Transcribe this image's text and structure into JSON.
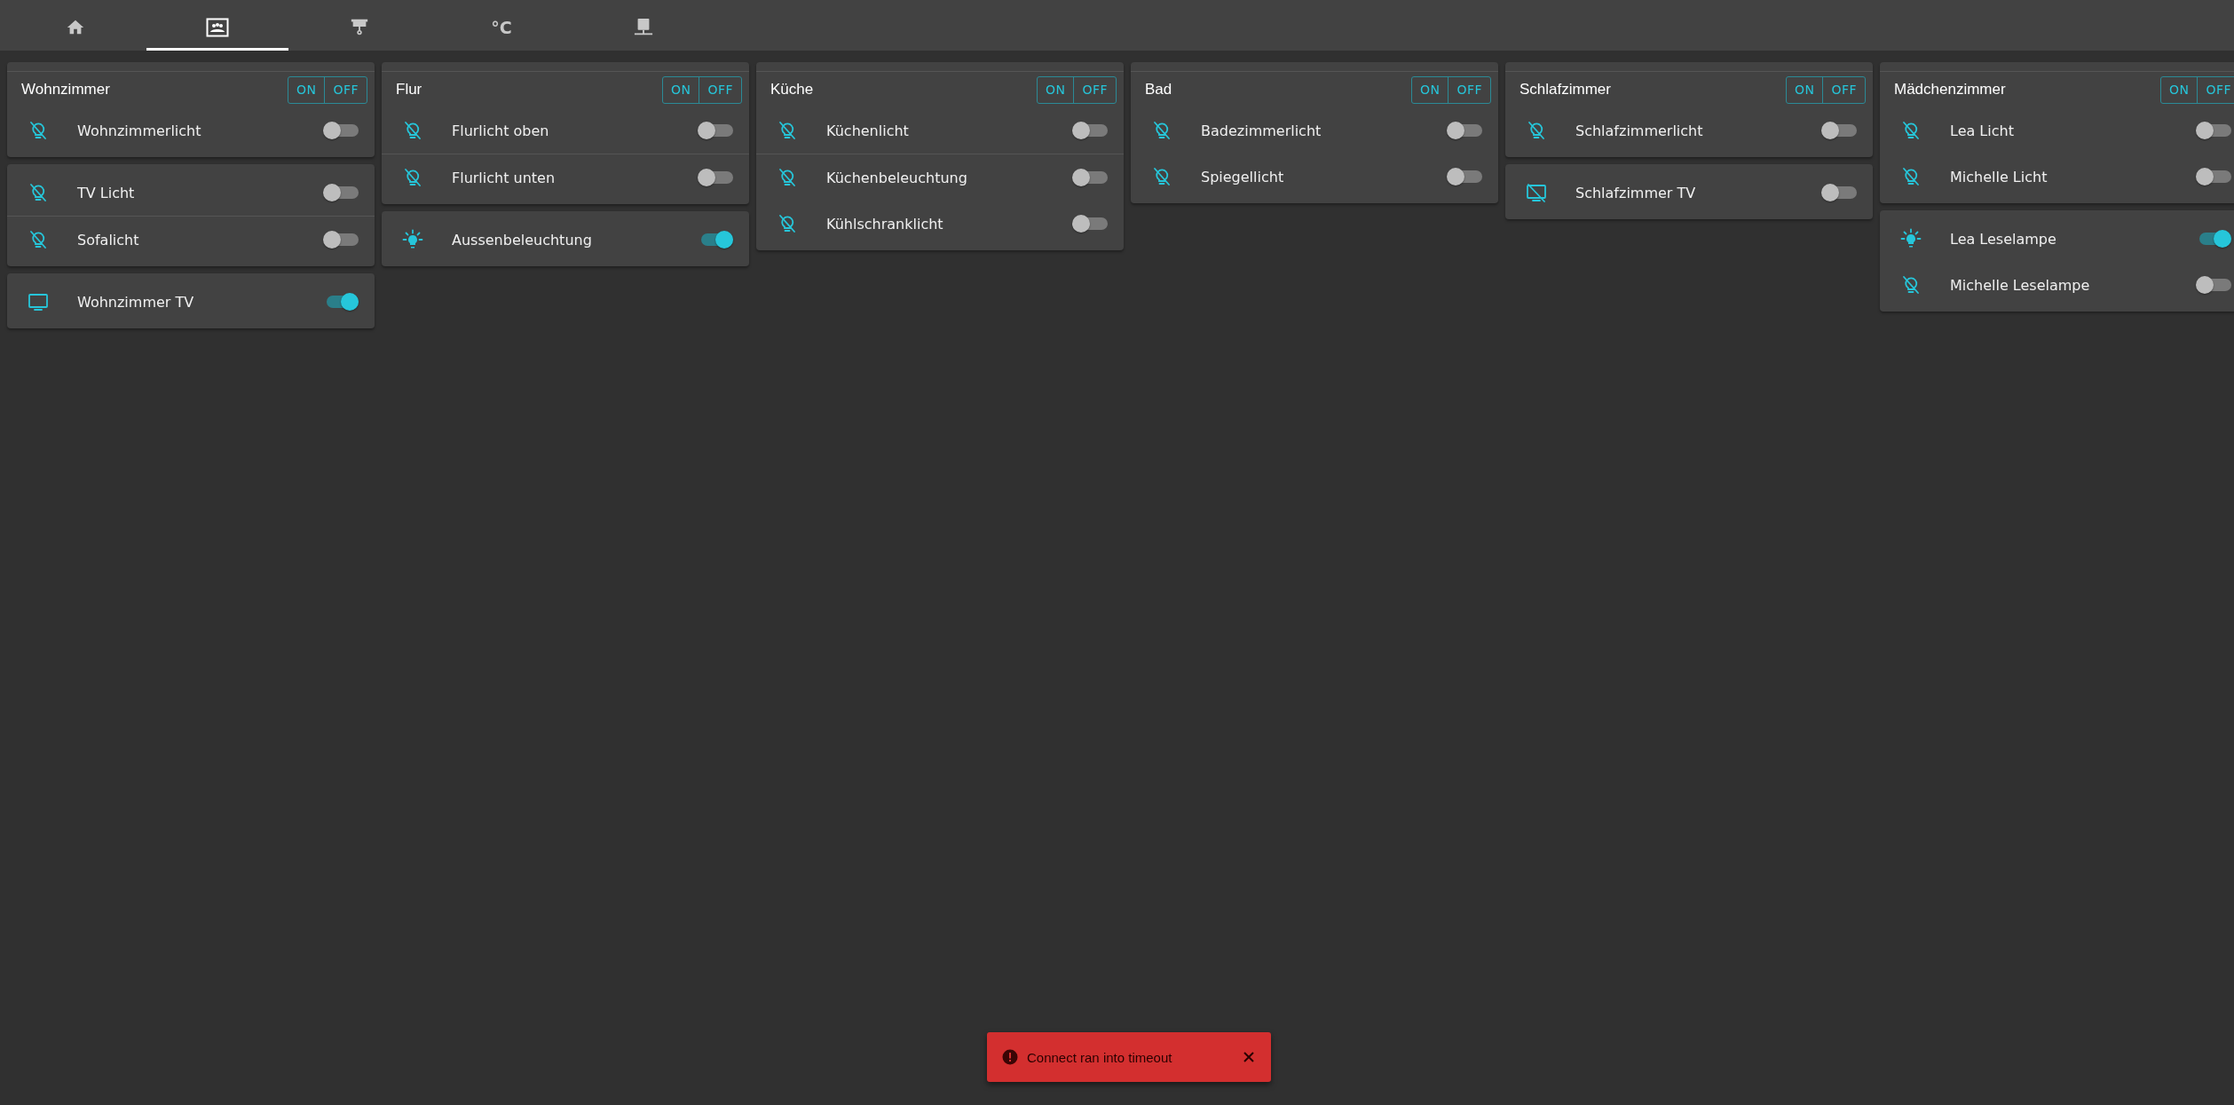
{
  "tabs": [
    {
      "kind": "home",
      "selected": false
    },
    {
      "kind": "gallery",
      "selected": true
    },
    {
      "kind": "projector",
      "selected": false
    },
    {
      "kind": "text",
      "label": "°C",
      "selected": false
    },
    {
      "kind": "network",
      "selected": false
    }
  ],
  "columns": [
    {
      "cards": [
        {
          "title": "Wohnzimmer",
          "buttons": [
            "ON",
            "OFF"
          ],
          "rows": [
            {
              "kind": "light",
              "name": "Wohnzimmerlicht",
              "on": false,
              "divider": false
            }
          ]
        },
        {
          "rows": [
            {
              "kind": "light",
              "name": "TV Licht",
              "on": false,
              "divider": true
            },
            {
              "kind": "light",
              "name": "Sofalicht",
              "on": false,
              "divider": false
            }
          ]
        },
        {
          "rows": [
            {
              "kind": "tv",
              "name": "Wohnzimmer TV",
              "on": true,
              "divider": false
            }
          ]
        }
      ]
    },
    {
      "cards": [
        {
          "title": "Flur",
          "buttons": [
            "ON",
            "OFF"
          ],
          "rows": [
            {
              "kind": "light",
              "name": "Flurlicht oben",
              "on": false,
              "divider": true
            },
            {
              "kind": "light",
              "name": "Flurlicht unten",
              "on": false,
              "divider": false
            }
          ]
        },
        {
          "rows": [
            {
              "kind": "light",
              "name": "Aussenbeleuchtung",
              "on": true,
              "divider": false
            }
          ]
        }
      ]
    },
    {
      "cards": [
        {
          "title": "Küche",
          "buttons": [
            "ON",
            "OFF"
          ],
          "rows": [
            {
              "kind": "light",
              "name": "Küchenlicht",
              "on": false,
              "divider": true
            },
            {
              "kind": "light",
              "name": "Küchenbeleuchtung",
              "on": false,
              "divider": false
            },
            {
              "kind": "light",
              "name": "Kühlschranklicht",
              "on": false,
              "divider": false
            }
          ]
        }
      ]
    },
    {
      "cards": [
        {
          "title": "Bad",
          "buttons": [
            "ON",
            "OFF"
          ],
          "rows": [
            {
              "kind": "light",
              "name": "Badezimmerlicht",
              "on": false,
              "divider": false
            },
            {
              "kind": "light",
              "name": "Spiegellicht",
              "on": false,
              "divider": false
            }
          ]
        }
      ]
    },
    {
      "cards": [
        {
          "title": "Schlafzimmer",
          "buttons": [
            "ON",
            "OFF"
          ],
          "rows": [
            {
              "kind": "light",
              "name": "Schlafzimmerlicht",
              "on": false,
              "divider": false
            }
          ]
        },
        {
          "rows": [
            {
              "kind": "tv",
              "name": "Schlafzimmer TV",
              "on": false,
              "divider": false
            }
          ]
        }
      ]
    },
    {
      "cards": [
        {
          "title": "Mädchenzimmer",
          "buttons": [
            "ON",
            "OFF"
          ],
          "rows": [
            {
              "kind": "light",
              "name": "Lea Licht",
              "on": false,
              "divider": false
            },
            {
              "kind": "light",
              "name": "Michelle Licht",
              "on": false,
              "divider": false
            }
          ]
        },
        {
          "rows": [
            {
              "kind": "light",
              "name": "Lea Leselampe",
              "on": true,
              "divider": false
            },
            {
              "kind": "light",
              "name": "Michelle Leselampe",
              "on": false,
              "divider": false
            }
          ]
        }
      ]
    }
  ],
  "toast": {
    "message": "Connect ran into timeout"
  }
}
